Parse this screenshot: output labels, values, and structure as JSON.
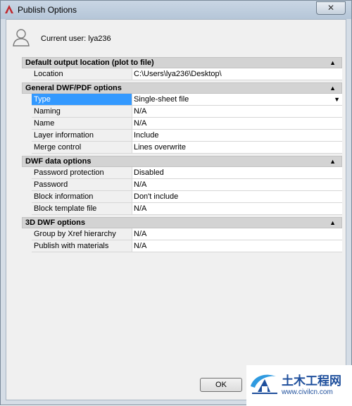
{
  "window": {
    "title": "Publish Options",
    "close_glyph": "✕"
  },
  "header": {
    "current_user": "Current user: lya236"
  },
  "sections": [
    {
      "title": "Default output location (plot to file)",
      "rows": [
        {
          "label": "Location",
          "value": "C:\\Users\\lya236\\Desktop\\"
        }
      ]
    },
    {
      "title": "General DWF/PDF options",
      "rows": [
        {
          "label": "Type",
          "value": "Single-sheet file"
        },
        {
          "label": "Naming",
          "value": "N/A"
        },
        {
          "label": "Name",
          "value": "N/A"
        },
        {
          "label": "Layer information",
          "value": "Include"
        },
        {
          "label": "Merge control",
          "value": "Lines overwrite"
        }
      ]
    },
    {
      "title": "DWF data options",
      "rows": [
        {
          "label": "Password protection",
          "value": "Disabled"
        },
        {
          "label": "Password",
          "value": "N/A"
        },
        {
          "label": "Block information",
          "value": "Don't include"
        },
        {
          "label": "Block template file",
          "value": "N/A"
        }
      ]
    },
    {
      "title": "3D DWF options",
      "rows": [
        {
          "label": "Group by Xref hierarchy",
          "value": "N/A"
        },
        {
          "label": "Publish with materials",
          "value": "N/A"
        }
      ]
    }
  ],
  "buttons": {
    "ok": "OK"
  },
  "watermark": {
    "title": "土木工程网",
    "url": "www.civilcn.com"
  },
  "icons": {
    "app": "autocad-icon",
    "user": "user-icon",
    "collapse": "collapse-arrow-icon",
    "dropdown": "dropdown-arrow-icon"
  },
  "colors": {
    "selection": "#3399ff",
    "category_bg": "#d3d3d3",
    "watermark_blue": "#1e4f9c"
  }
}
